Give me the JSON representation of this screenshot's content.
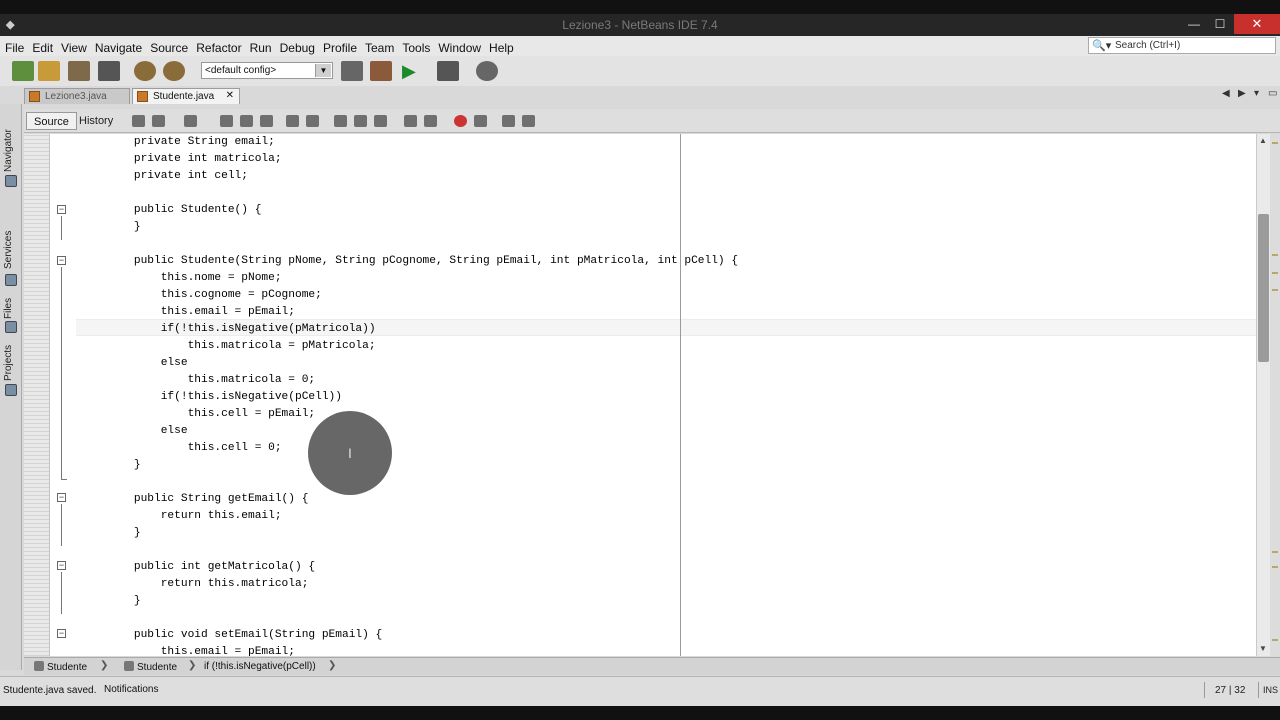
{
  "window": {
    "title": "Lezione3 - NetBeans IDE 7.4",
    "close_glyph": "✕",
    "minimize_glyph": "—",
    "maximize_glyph": "☐"
  },
  "menu": [
    "File",
    "Edit",
    "View",
    "Navigate",
    "Source",
    "Refactor",
    "Run",
    "Debug",
    "Profile",
    "Team",
    "Tools",
    "Window",
    "Help"
  ],
  "search": {
    "placeholder": "Search (Ctrl+I)",
    "icon": "search-icon"
  },
  "toolbar": {
    "config": "<default config>"
  },
  "tabs": [
    {
      "label": "Lezione3.java",
      "active": false
    },
    {
      "label": "Studente.java",
      "active": true,
      "close": "✕"
    }
  ],
  "sidebar": [
    "Navigator",
    "Services",
    "Files",
    "Projects"
  ],
  "editor_tabs": {
    "source": "Source",
    "history": "History"
  },
  "code_lines": [
    "    private String email;",
    "    private int matricola;",
    "    private int cell;",
    "",
    "    public Studente() {",
    "    }",
    "",
    "    public Studente(String pNome, String pCognome, String pEmail, int pMatricola, int pCell) {",
    "        this.nome = pNome;",
    "        this.cognome = pCognome;",
    "        this.email = pEmail;",
    "        if(!this.isNegative(pMatricola))",
    "            this.matricola = pMatricola;",
    "        else",
    "            this.matricola = 0;",
    "        if(!this.isNegative(pCell))",
    "            this.cell = pEmail;",
    "        else",
    "            this.cell = 0;",
    "    }",
    "",
    "    public String getEmail() {",
    "        return this.email;",
    "    }",
    "",
    "    public int getMatricola() {",
    "        return this.matricola;",
    "    }",
    "",
    "    public void setEmail(String pEmail) {",
    "        this.email = pEmail;"
  ],
  "breadcrumb": [
    "Studente",
    "Studente",
    "if (!this.isNegative(pCell))"
  ],
  "status": {
    "message": "Studente.java saved.",
    "notifications": "Notifications",
    "position": "27 | 32",
    "mode": "INS"
  }
}
